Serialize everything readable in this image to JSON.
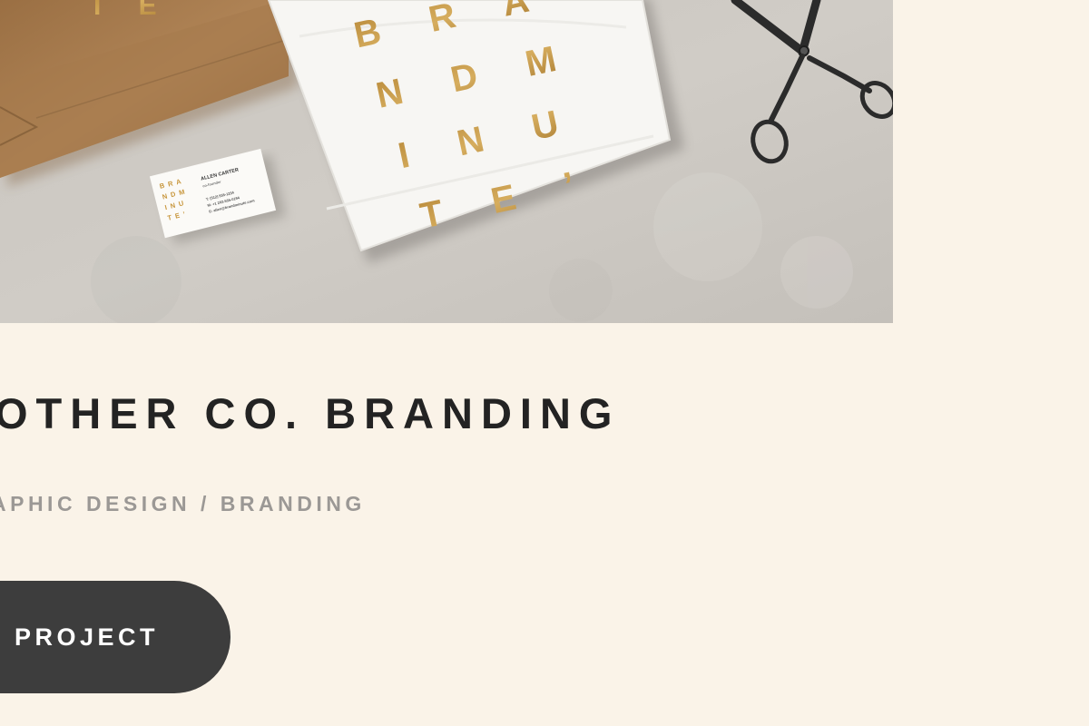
{
  "hero": {
    "description_icon": "branding-mockup-photo",
    "business_card": {
      "brand_lines": [
        "B R A",
        "N D  M",
        "I  N U",
        "T E ’"
      ],
      "name": "ALLEN CARTER",
      "role": "co-founder",
      "contact_lines": [
        "T: (512) 555-1234",
        "M: +1 202-555-0194",
        "E: allen@brandminute.com"
      ]
    },
    "tshirt_letters": [
      "B R A",
      "N D  M",
      "I  N U",
      "T E ’"
    ],
    "bag_letters": "T E"
  },
  "project": {
    "title": "OTHER CO. BRANDING",
    "categories": "APHIC DESIGN / BRANDING",
    "cta_label": "PROJECT"
  },
  "colors": {
    "background": "#faf3e8",
    "title": "#232323",
    "categories": "#9b9895",
    "button": "#3d3d3d",
    "gold": "#b8893c"
  }
}
